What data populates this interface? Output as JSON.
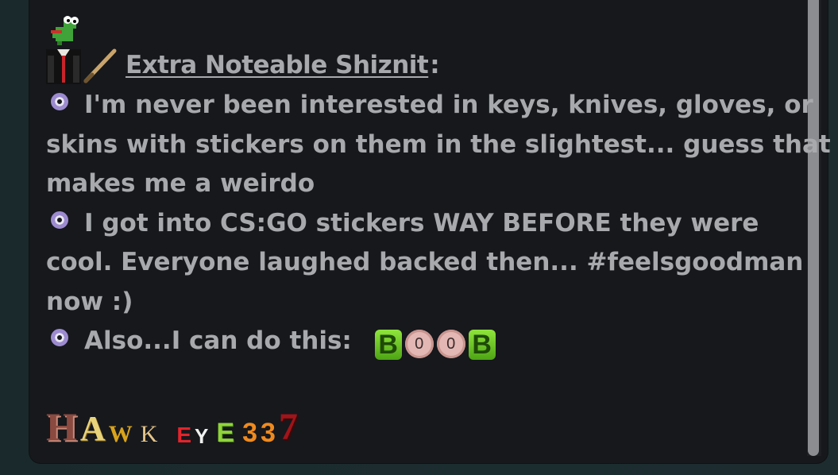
{
  "heading": {
    "title": "Extra Noteable Shiznit ",
    "suffix": ":"
  },
  "bullets": [
    {
      "lines": [
        "I'm never been interested in keys, knives, gloves, or",
        "skins with stickers on them in the slightest... guess that",
        "makes me a weirdo"
      ]
    },
    {
      "lines": [
        "I got into CS:GO stickers WAY BEFORE they were",
        "cool. Everyone laughed backed then... #feelsgoodman",
        "now :)"
      ]
    },
    {
      "lines": [
        "Also...I can do this:"
      ]
    }
  ],
  "boob_emotes": [
    "B",
    "0",
    "0",
    "B"
  ],
  "signature_letters": [
    "H",
    "A",
    "W",
    "K",
    "E",
    "Y",
    "E",
    "3",
    "3",
    "7"
  ],
  "colors": {
    "bullet_ring": "#9d8bd0",
    "text": "#a7a9ad",
    "panel": "#16181c",
    "page_bg": "#1b2b2e"
  }
}
